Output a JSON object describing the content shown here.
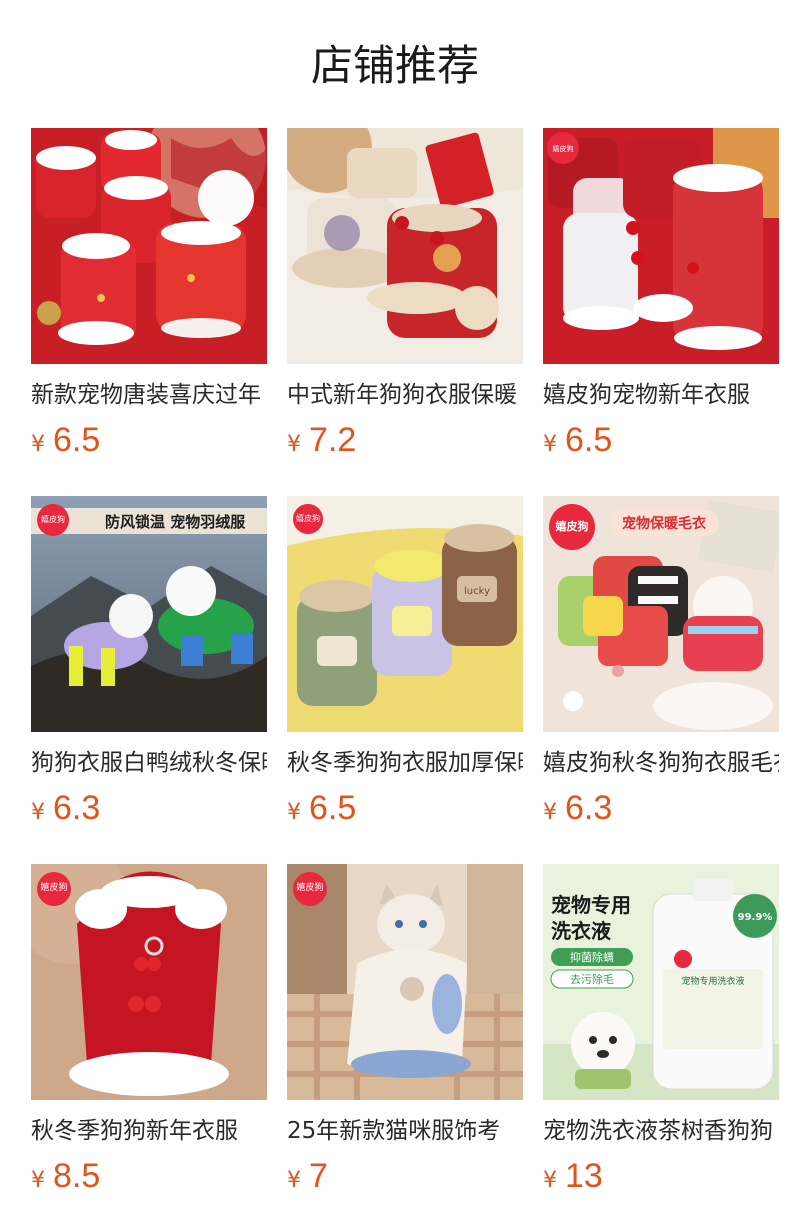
{
  "page_title": "店铺推荐",
  "currency_symbol": "¥",
  "products": [
    {
      "name": "新款宠物唐装喜庆过年",
      "price": "6.5",
      "image": "red-tang-suit-dog-clothes-photo"
    },
    {
      "name": "中式新年狗狗衣服保暖",
      "price": "7.2",
      "image": "chinese-new-year-dog-coat-photo"
    },
    {
      "name": "嬉皮狗宠物新年衣服",
      "price": "6.5",
      "image": "pet-new-year-clothes-photo"
    },
    {
      "name": "狗狗衣服白鸭绒秋冬保暖",
      "price": "6.3",
      "image": "dog-down-jacket-photo",
      "overlay": {
        "badge": "嬉皮狗",
        "banner": "防风锁温 宠物羽绒服"
      }
    },
    {
      "name": "秋冬季狗狗衣服加厚保暖",
      "price": "6.5",
      "image": "dog-fleece-clothes-photo",
      "overlay": {
        "badge": "嬉皮狗",
        "tag": "lucky"
      }
    },
    {
      "name": "嬉皮狗秋冬狗狗衣服毛衣",
      "price": "6.3",
      "image": "dog-sweater-photo",
      "overlay": {
        "badge": "嬉皮狗",
        "banner": "宠物保暖毛衣"
      }
    },
    {
      "name": "秋冬季狗狗新年衣服",
      "price": "8.5",
      "image": "red-dog-vest-photo",
      "overlay": {
        "badge": "嬉皮狗"
      }
    },
    {
      "name": "25年新款猫咪服饰考",
      "price": "7",
      "image": "cat-sweater-photo",
      "overlay": {
        "badge": "嬉皮狗"
      }
    },
    {
      "name": "宠物洗衣液茶树香狗狗",
      "price": "13",
      "image": "pet-laundry-detergent-photo",
      "overlay": {
        "headline1": "宠物专用",
        "headline2": "洗衣液",
        "chip1": "抑菌除螨",
        "chip2": "去污除毛",
        "stat": "99.9%",
        "label": "宠物专用洗衣液"
      }
    }
  ],
  "colors": {
    "price": "#e2541c",
    "brand_red": "#e8283c"
  }
}
